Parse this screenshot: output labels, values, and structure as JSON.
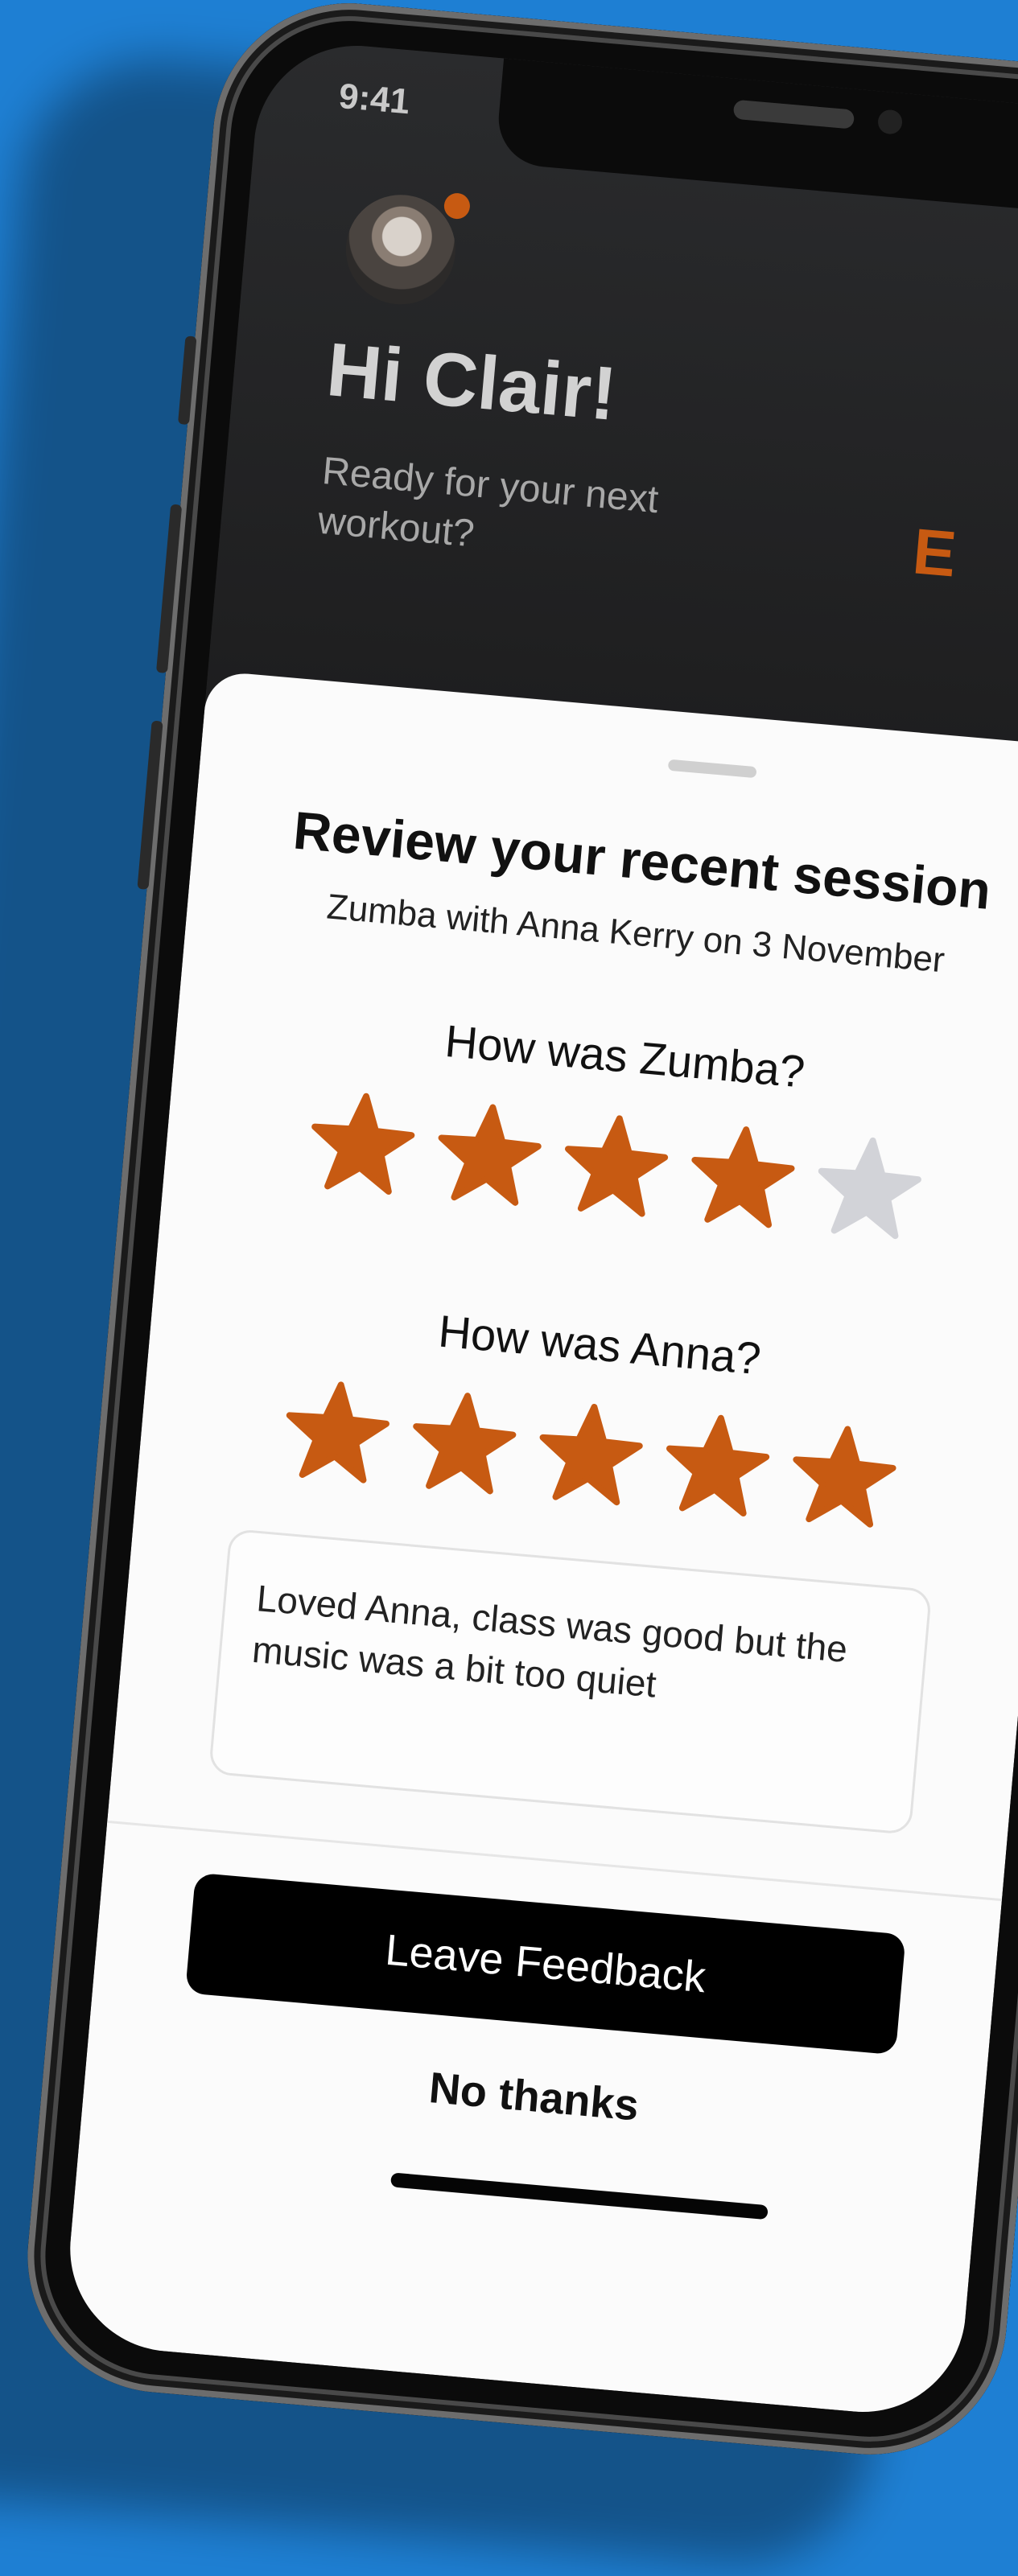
{
  "status_bar": {
    "time": "9:41"
  },
  "header": {
    "greeting": "Hi Clair!",
    "subtitle": "Ready for your next workout?",
    "accent_partial": "E"
  },
  "review_sheet": {
    "title": "Review your recent session",
    "subtitle": "Zumba with Anna Kerry on 3 November",
    "question_class": "How was Zumba?",
    "question_instructor": "How was Anna?",
    "class_rating": 4,
    "instructor_rating": 5,
    "max_rating": 5,
    "comment": "Loved Anna, class was good but the music was a bit too quiet",
    "primary_button": "Leave Feedback",
    "secondary_button": "No thanks"
  },
  "colors": {
    "background": "#1e7fd3",
    "accent": "#c75a12",
    "star_empty": "#d2d3d8",
    "primary_button": "#000000"
  },
  "icons": {
    "avatar": "user-avatar-photo",
    "star": "star-icon"
  }
}
